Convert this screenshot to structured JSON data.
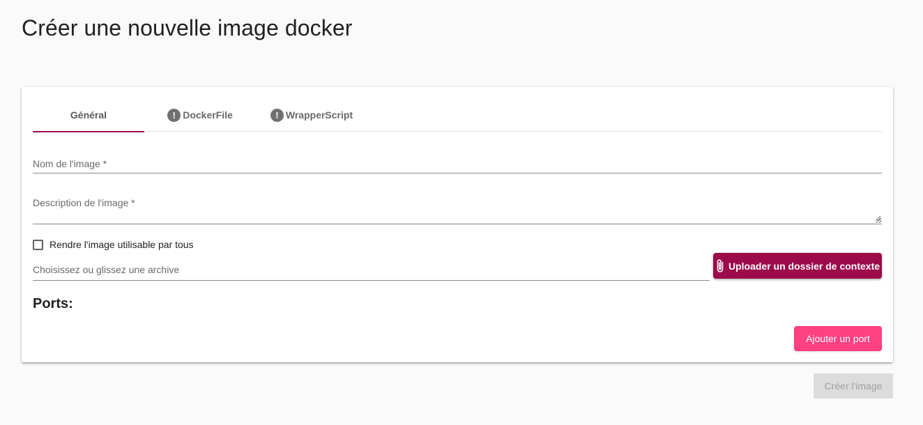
{
  "page": {
    "title": "Créer une nouvelle image docker"
  },
  "tabs": [
    {
      "label": "Général",
      "active": true,
      "icon": ""
    },
    {
      "label": "DockerFile",
      "active": false,
      "icon": "alert-circle-icon"
    },
    {
      "label": "WrapperScript",
      "active": false,
      "icon": "alert-circle-icon"
    }
  ],
  "form": {
    "name_placeholder": "Nom de l'image *",
    "name_value": "",
    "description_placeholder": "Description de l'image *",
    "description_value": "",
    "public_checkbox_label": "Rendre l'image utilisable par tous",
    "public_checked": false,
    "archive_placeholder": "Choisissez ou glissez une archive",
    "archive_value": "",
    "upload_button_label": "Uploader un dossier de contexte"
  },
  "ports": {
    "title": "Ports:",
    "add_button_label": "Ajouter un port"
  },
  "actions": {
    "create_button_label": "Créer l'image"
  },
  "colors": {
    "primary": "#9c0a4a",
    "accent": "#ff4081",
    "disabled": "#dcdcdc"
  }
}
